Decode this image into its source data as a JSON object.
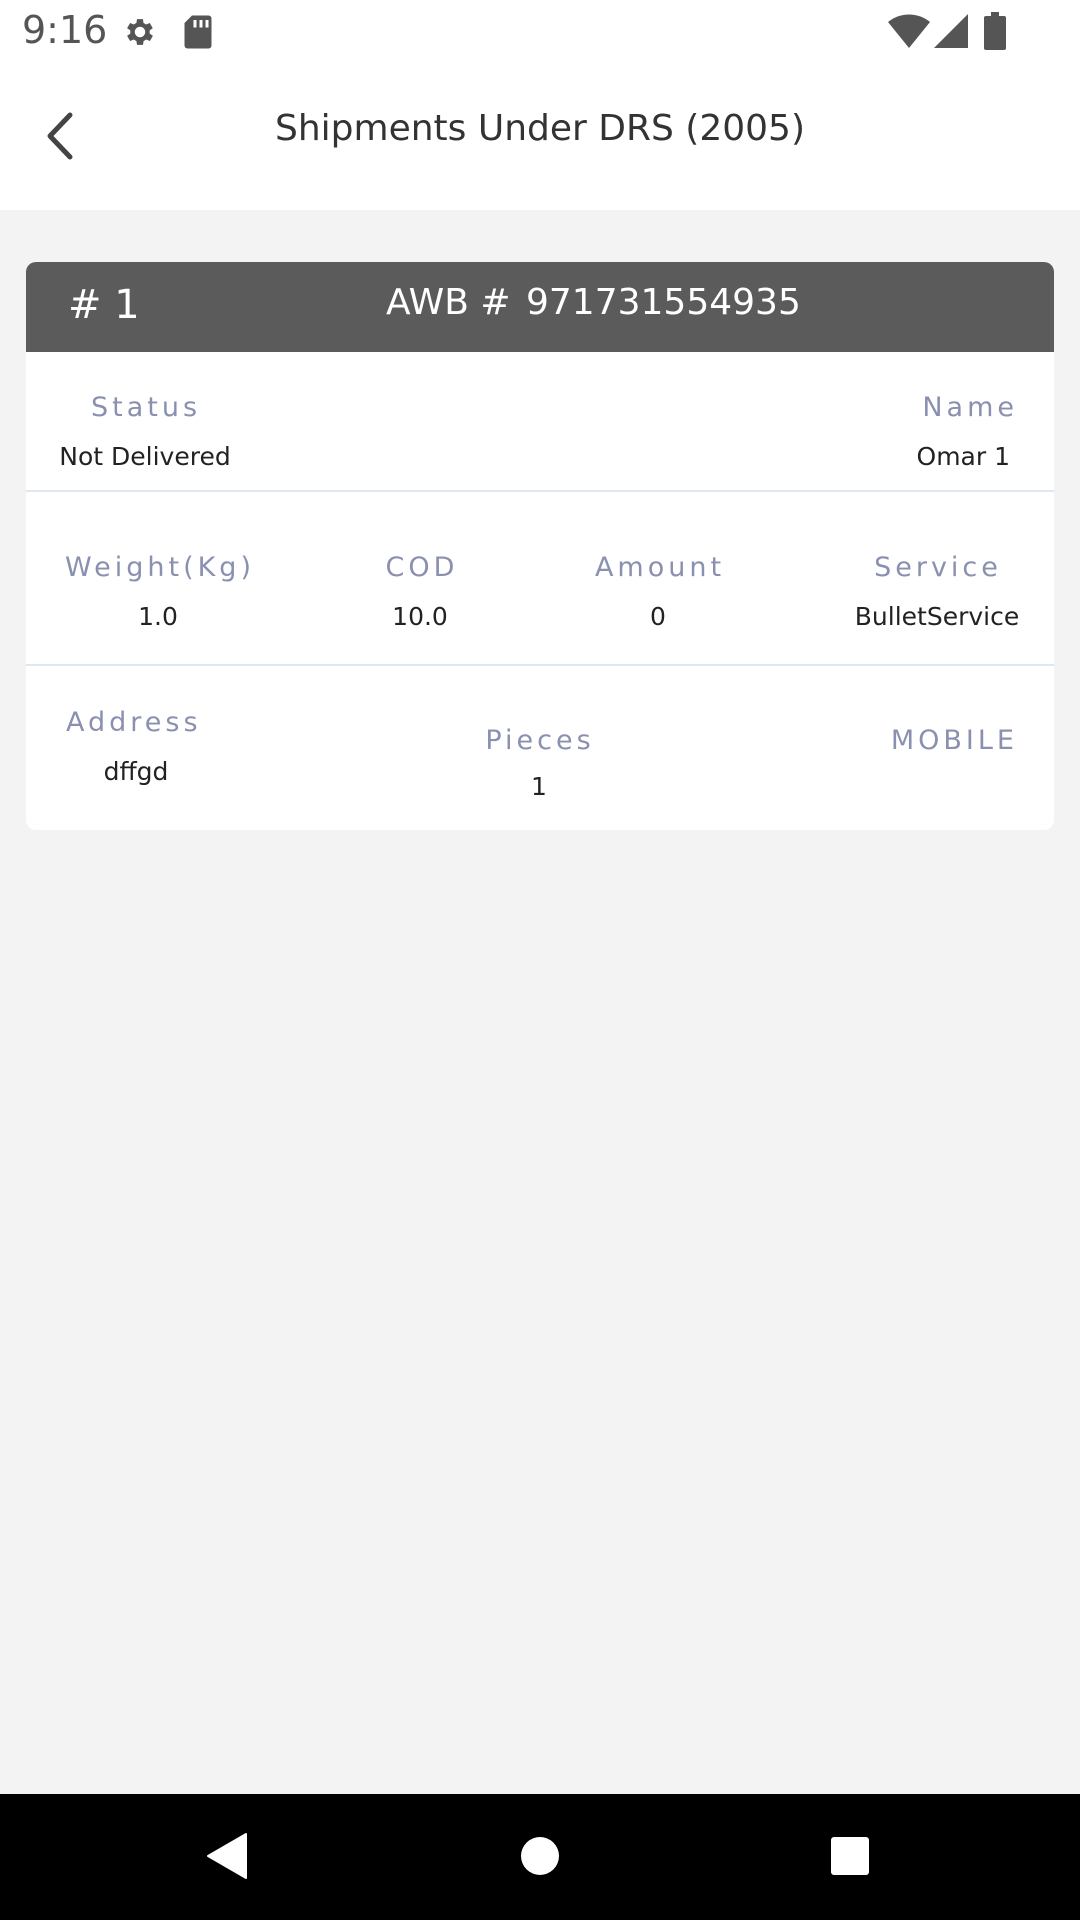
{
  "status_bar": {
    "time": "9:16",
    "left_icons": [
      "gear-icon",
      "sd-card-icon"
    ],
    "right_icons": [
      "wifi-icon",
      "signal-icon",
      "battery-icon"
    ]
  },
  "header": {
    "title": "Shipments Under DRS (2005)",
    "back_icon": "chevron-left-icon"
  },
  "shipment": {
    "index": "# 1",
    "awb_label": "AWB #",
    "awb_value": "971731554935",
    "status_label": "Status",
    "status_value": "Not Delivered",
    "name_label": "Name",
    "name_value": "Omar 1",
    "weight_label": "Weight(Kg)",
    "weight_value": "1.0",
    "cod_label": "COD",
    "cod_value": "10.0",
    "amount_label": "Amount",
    "amount_value": "0",
    "service_label": "Service",
    "service_value": "BulletService",
    "address_label": "Address",
    "address_value": "dffgd",
    "pieces_label": "Pieces",
    "pieces_value": "1",
    "mobile_label": "MOBILE"
  },
  "colors": {
    "card_header": "#5b5b5b",
    "label": "#8a90b0",
    "background": "#f3f3f4"
  },
  "nav_bar": {
    "icons": [
      "back-triangle-icon",
      "home-circle-icon",
      "recents-square-icon"
    ]
  }
}
